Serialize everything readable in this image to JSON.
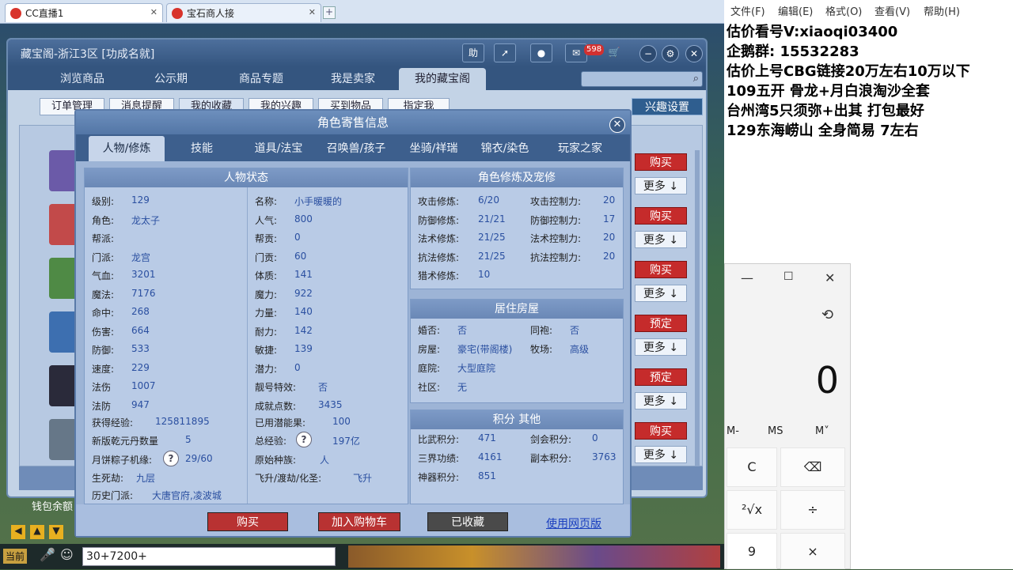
{
  "browser": {
    "tabs": [
      {
        "title": "CC直播1"
      },
      {
        "title": "宝石商人接"
      }
    ],
    "new_tab": "+"
  },
  "cbg": {
    "title": "藏宝阁-浙江3区 [功成名就]",
    "title_buttons": {
      "help": "助",
      "message_count": "598"
    },
    "nav": [
      "浏览商品",
      "公示期",
      "商品专题",
      "我是卖家",
      "我的藏宝阁"
    ],
    "subtabs": [
      "订单管理",
      "消息提醒",
      "我的收藏",
      "我的兴趣",
      "买到物品",
      "指定我"
    ],
    "interest_settings": "兴趣设置",
    "row_buttons": [
      {
        "primary": "购买",
        "more": "更多"
      },
      {
        "primary": "购买",
        "more": "更多"
      },
      {
        "primary": "购买",
        "more": "更多"
      },
      {
        "primary": "预定",
        "more": "更多"
      },
      {
        "primary": "预定",
        "more": "更多"
      },
      {
        "primary": "购买",
        "more": "更多"
      }
    ],
    "wallet": "钱包余额"
  },
  "dialog": {
    "title": "角色寄售信息",
    "close": "✕",
    "tabs": [
      "人物/修炼",
      "技能",
      "道具/法宝",
      "召唤兽/孩子",
      "坐骑/祥瑞",
      "锦衣/染色",
      "玩家之家"
    ],
    "status": {
      "header": "人物状态",
      "left": [
        {
          "label": "级别:",
          "value": "129"
        },
        {
          "label": "角色:",
          "value": "龙太子"
        },
        {
          "label": "帮派:",
          "value": ""
        },
        {
          "label": "门派:",
          "value": "龙宫"
        },
        {
          "label": "气血:",
          "value": "3201"
        },
        {
          "label": "魔法:",
          "value": "7176"
        },
        {
          "label": "命中:",
          "value": "268"
        },
        {
          "label": "伤害:",
          "value": "664"
        },
        {
          "label": "防御:",
          "value": "533"
        },
        {
          "label": "速度:",
          "value": "229"
        },
        {
          "label": "法伤",
          "value": "1007"
        },
        {
          "label": "法防",
          "value": "947"
        }
      ],
      "right": [
        {
          "label": "名称:",
          "value": "小手暖暖的"
        },
        {
          "label": "人气:",
          "value": "800"
        },
        {
          "label": "帮贡:",
          "value": "0"
        },
        {
          "label": "门贡:",
          "value": "60"
        },
        {
          "label": "体质:",
          "value": "141"
        },
        {
          "label": "魔力:",
          "value": "922"
        },
        {
          "label": "力量:",
          "value": "140"
        },
        {
          "label": "耐力:",
          "value": "142"
        },
        {
          "label": "敏捷:",
          "value": "139"
        },
        {
          "label": "潜力:",
          "value": "0"
        },
        {
          "label": "靓号特效:",
          "value": "否"
        },
        {
          "label": "成就点数:",
          "value": "3435"
        }
      ],
      "extra": [
        {
          "label": "获得经验:",
          "value": "125811895"
        },
        {
          "label": "已用潜能果:",
          "value": "100"
        },
        {
          "label": "新版乾元丹数量",
          "value": "5"
        },
        {
          "label": "总经验:",
          "value": "197亿"
        },
        {
          "label": "月饼粽子机缘:",
          "value": "29/60"
        },
        {
          "label": "原始种族:",
          "value": "人"
        },
        {
          "label": "生死劫:",
          "value": "九层"
        },
        {
          "label": "飞升/渡劫/化圣:",
          "value": "飞升"
        },
        {
          "label": "历史门派:",
          "value": "大唐官府,凌波城"
        }
      ]
    },
    "cultivation": {
      "header": "角色修炼及宠修",
      "rows": [
        {
          "a_label": "攻击修炼:",
          "a_value": "6/20",
          "b_label": "攻击控制力:",
          "b_value": "20"
        },
        {
          "a_label": "防御修炼:",
          "a_value": "21/21",
          "b_label": "防御控制力:",
          "b_value": "17"
        },
        {
          "a_label": "法术修炼:",
          "a_value": "21/25",
          "b_label": "法术控制力:",
          "b_value": "20"
        },
        {
          "a_label": "抗法修炼:",
          "a_value": "21/25",
          "b_label": "抗法控制力:",
          "b_value": "20"
        },
        {
          "a_label": "猎术修炼:",
          "a_value": "10",
          "b_label": "",
          "b_value": ""
        }
      ]
    },
    "housing": {
      "header": "居住房屋",
      "rows": [
        {
          "a_label": "婚否:",
          "a_value": "否",
          "b_label": "同袍:",
          "b_value": "否"
        },
        {
          "a_label": "房屋:",
          "a_value": "豪宅(带阁楼)",
          "b_label": "牧场:",
          "b_value": "高级"
        },
        {
          "a_label": "庭院:",
          "a_value": "大型庭院",
          "b_label": "",
          "b_value": ""
        },
        {
          "a_label": "社区:",
          "a_value": "无",
          "b_label": "",
          "b_value": ""
        }
      ]
    },
    "points": {
      "header": "积分 其他",
      "rows": [
        {
          "a_label": "比武积分:",
          "a_value": "471",
          "b_label": "剑会积分:",
          "b_value": "0"
        },
        {
          "a_label": "三界功绩:",
          "a_value": "4161",
          "b_label": "副本积分:",
          "b_value": "3763"
        },
        {
          "a_label": "神器积分:",
          "a_value": "851",
          "b_label": "",
          "b_value": ""
        }
      ]
    },
    "buttons": {
      "buy": "购买",
      "cart": "加入购物车",
      "collected": "已收藏",
      "web": "使用网页版"
    }
  },
  "game": {
    "chat_input": "30+7200+",
    "now_label": "当前"
  },
  "notepad": {
    "menu": [
      "文件(F)",
      "编辑(E)",
      "格式(O)",
      "查看(V)",
      "帮助(H)"
    ],
    "lines": [
      "估价看号V:xiaoqi03400",
      "企鹅群: 15532283",
      "估价上号CBG链接20万左右10万以下",
      "109五开 骨龙+月白浪淘沙全套",
      "台州湾5只须弥+出其 打包最好",
      "129东海崂山 全身简易  7左右"
    ]
  },
  "calculator": {
    "display": "0",
    "memory": [
      "M-",
      "MS",
      "M˅"
    ],
    "keys": [
      "C",
      "⌫",
      "²√x",
      "÷",
      "9",
      "×"
    ]
  },
  "colors": {
    "accent_blue": "#34557f",
    "buy_red": "#c52b2b",
    "value_blue": "#2a4fa0"
  }
}
